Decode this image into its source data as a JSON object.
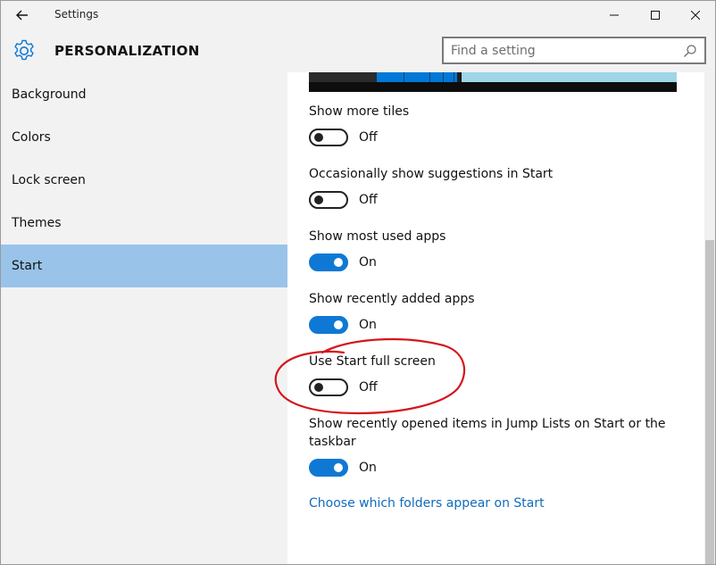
{
  "window": {
    "title": "Settings"
  },
  "header": {
    "section_title": "PERSONALIZATION",
    "search_placeholder": "Find a setting"
  },
  "icons": {
    "back": "back-arrow-icon",
    "minimize": "minimize-icon",
    "maximize": "maximize-icon",
    "close": "close-icon",
    "settings": "gear-icon",
    "search": "search-icon"
  },
  "sidebar": {
    "items": [
      {
        "label": "Background"
      },
      {
        "label": "Colors"
      },
      {
        "label": "Lock screen"
      },
      {
        "label": "Themes"
      },
      {
        "label": "Start",
        "selected": true
      }
    ]
  },
  "settings": [
    {
      "label": "Show more tiles",
      "state": "Off"
    },
    {
      "label": "Occasionally show suggestions in Start",
      "state": "Off"
    },
    {
      "label": "Show most used apps",
      "state": "On"
    },
    {
      "label": "Show recently added apps",
      "state": "On"
    },
    {
      "label": "Use Start full screen",
      "state": "Off"
    },
    {
      "label_line1": "Show recently opened items in Jump Lists on Start or the",
      "label_line2": "taskbar",
      "state": "On"
    }
  ],
  "link": {
    "label": "Choose which folders appear on Start"
  },
  "colors": {
    "accent": "#0f78d5",
    "selected_nav": "#99c3e9",
    "annotation": "#d4161d"
  }
}
